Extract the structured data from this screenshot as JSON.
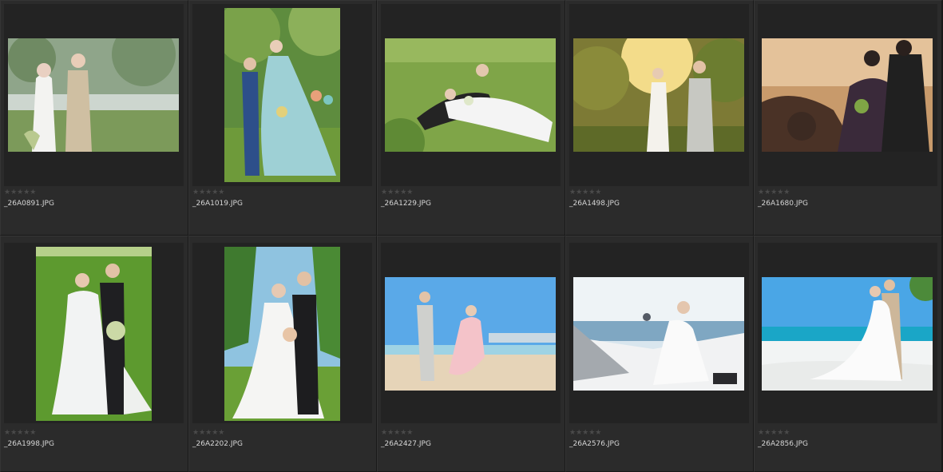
{
  "grid": {
    "items": [
      {
        "filename": "_26A0891.JPG",
        "rating": "★★★★★",
        "orientation": "landscape"
      },
      {
        "filename": "_26A1019.JPG",
        "rating": "★★★★★",
        "orientation": "portrait"
      },
      {
        "filename": "_26A1229.JPG",
        "rating": "★★★★★",
        "orientation": "landscape"
      },
      {
        "filename": "_26A1498.JPG",
        "rating": "★★★★★",
        "orientation": "landscape"
      },
      {
        "filename": "_26A1680.JPG",
        "rating": "★★★★★",
        "orientation": "landscape"
      },
      {
        "filename": "_26A1998.JPG",
        "rating": "★★★★★",
        "orientation": "portrait"
      },
      {
        "filename": "_26A2202.JPG",
        "rating": "★★★★★",
        "orientation": "portrait"
      },
      {
        "filename": "_26A2427.JPG",
        "rating": "★★★★★",
        "orientation": "landscape"
      },
      {
        "filename": "_26A2576.JPG",
        "rating": "★★★★★",
        "orientation": "landscape"
      },
      {
        "filename": "_26A2856.JPG",
        "rating": "★★★★★",
        "orientation": "landscape"
      }
    ]
  },
  "colors": {
    "background": "#191919",
    "cell": "#2b2b2b",
    "frame": "#232323",
    "text": "#d6d6d6",
    "stars": "#4a4a4a"
  }
}
